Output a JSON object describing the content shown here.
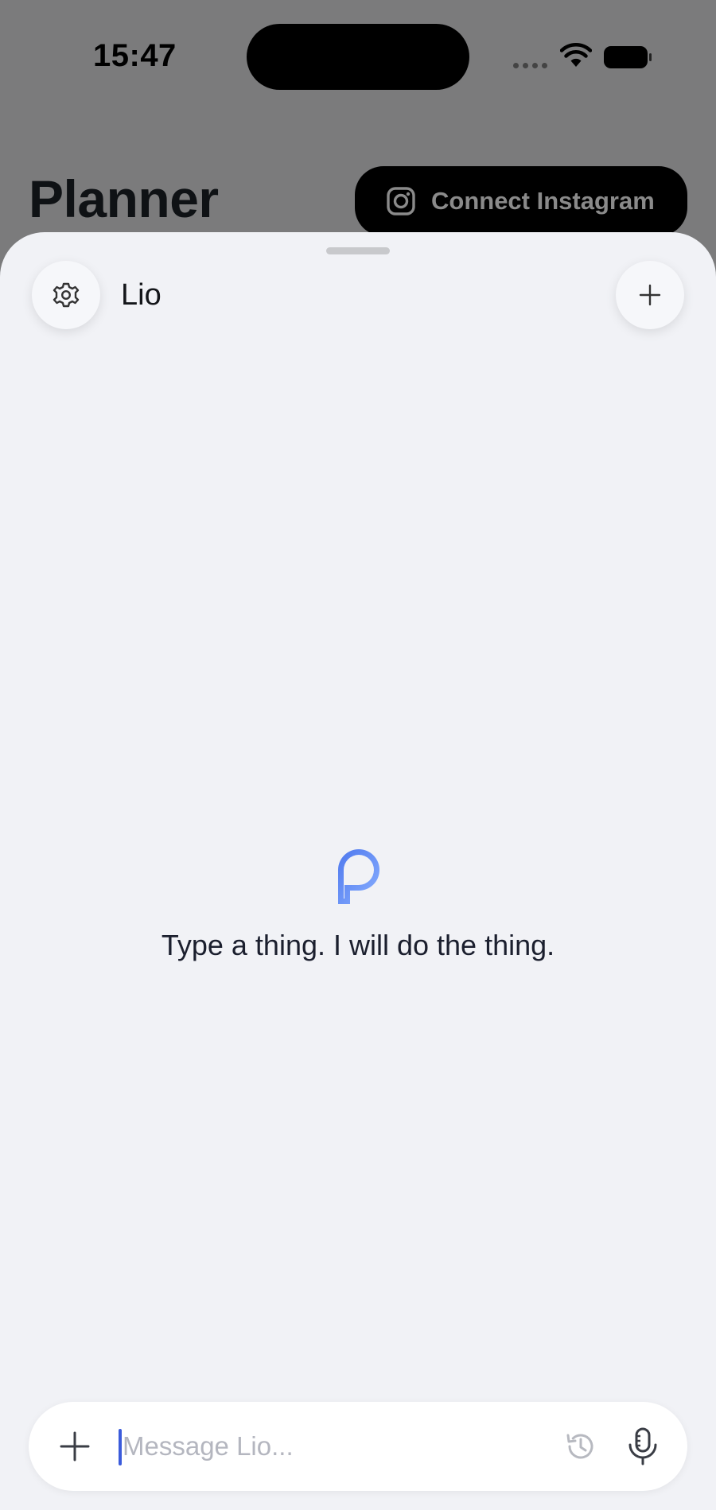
{
  "status_bar": {
    "time": "15:47"
  },
  "planner": {
    "title": "Planner",
    "connect_label": "Connect Instagram"
  },
  "sheet": {
    "assistant_name": "Lio",
    "tagline": "Type a thing. I will do the thing."
  },
  "composer": {
    "placeholder": "Message Lio..."
  },
  "icons": {
    "settings": "gear-icon",
    "new_chat": "plus-icon",
    "attach": "plus-icon",
    "history": "history-icon",
    "voice": "microphone-icon",
    "brand": "lio-logo-icon",
    "instagram": "instagram-icon"
  },
  "colors": {
    "sheet_background": "#f1f2f6",
    "accent": "#4f7ff0",
    "caret": "#3b5bdb"
  }
}
